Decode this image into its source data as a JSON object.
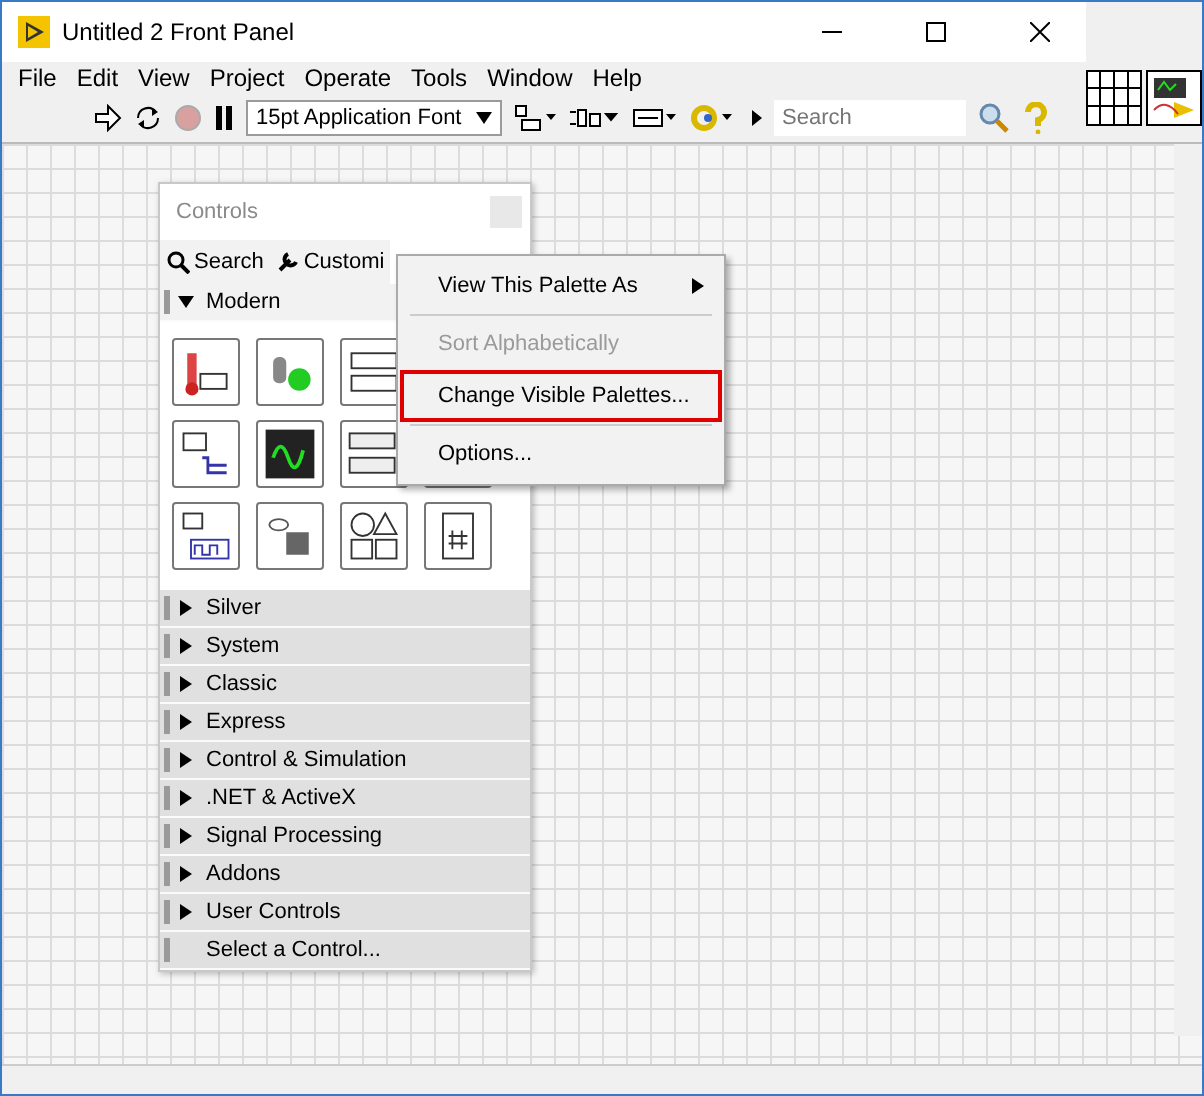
{
  "window": {
    "title": "Untitled 2 Front Panel"
  },
  "menu_bar": [
    "File",
    "Edit",
    "View",
    "Project",
    "Operate",
    "Tools",
    "Window",
    "Help"
  ],
  "toolbar": {
    "font_select": "15pt Application Font",
    "search": {
      "placeholder": "Search"
    }
  },
  "palette": {
    "title": "Controls",
    "tabs": [
      "Search",
      "Customi"
    ],
    "categories": [
      {
        "label": "Modern",
        "kind": "category",
        "expanded": true
      },
      {
        "label": "Silver",
        "kind": "category",
        "expanded": false
      },
      {
        "label": "System",
        "kind": "category",
        "expanded": false
      },
      {
        "label": "Classic",
        "kind": "category",
        "expanded": false
      },
      {
        "label": "Express",
        "kind": "category",
        "expanded": false
      },
      {
        "label": "Control & Simulation",
        "kind": "category",
        "expanded": false
      },
      {
        "label": ".NET & ActiveX",
        "kind": "category",
        "expanded": false
      },
      {
        "label": "Signal Processing",
        "kind": "category",
        "expanded": false
      },
      {
        "label": "Addons",
        "kind": "category",
        "expanded": false
      },
      {
        "label": "User Controls",
        "kind": "category",
        "expanded": false
      },
      {
        "label": "Select a Control...",
        "kind": "action"
      }
    ]
  },
  "context_menu": [
    {
      "label": "View This Palette As",
      "disabled": false,
      "submenu": true,
      "highlighted": false
    },
    {
      "label": "Sort Alphabetically",
      "disabled": true,
      "submenu": false,
      "highlighted": false
    },
    {
      "label": "Change Visible Palettes...",
      "disabled": false,
      "submenu": false,
      "highlighted": true
    },
    {
      "label": "Options...",
      "disabled": false,
      "submenu": false,
      "highlighted": false
    }
  ]
}
